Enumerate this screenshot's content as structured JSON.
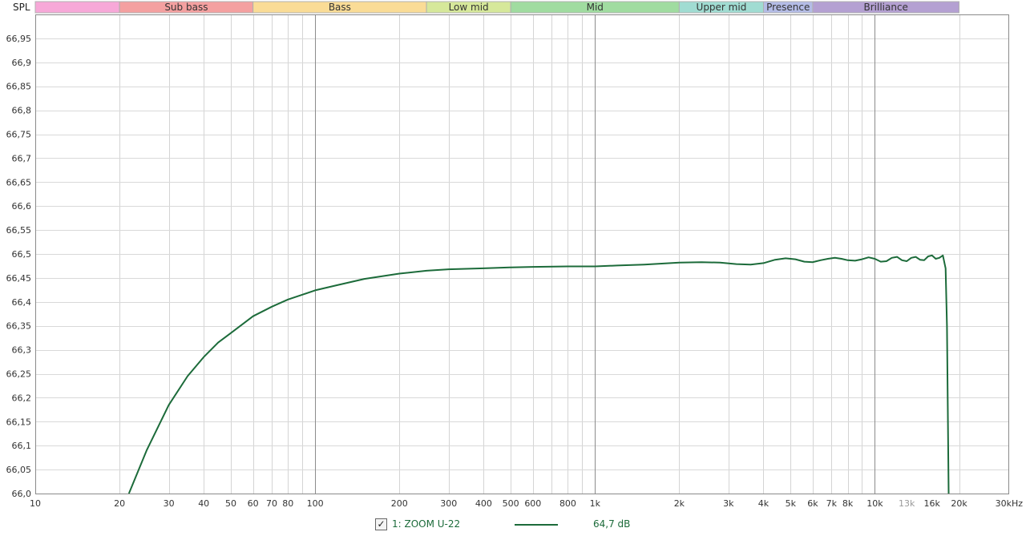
{
  "chart_data": {
    "type": "line",
    "y_axis_label": "SPL",
    "x_axis_unit": "kHz",
    "x_scale": "log",
    "xlim": [
      10,
      30000
    ],
    "ylim": [
      66.0,
      67.0
    ],
    "grid": true,
    "y_tick_labels": [
      "66,0",
      "66,05",
      "66,1",
      "66,15",
      "66,2",
      "66,25",
      "66,3",
      "66,35",
      "66,4",
      "66,45",
      "66,5",
      "66,55",
      "66,6",
      "66,65",
      "66,7",
      "66,75",
      "66,8",
      "66,85",
      "66,9",
      "66,95"
    ],
    "x_tick_labels": [
      {
        "value": 10,
        "label": "10"
      },
      {
        "value": 20,
        "label": "20"
      },
      {
        "value": 30,
        "label": "30"
      },
      {
        "value": 40,
        "label": "40"
      },
      {
        "value": 50,
        "label": "50"
      },
      {
        "value": 60,
        "label": "60"
      },
      {
        "value": 70,
        "label": "70"
      },
      {
        "value": 80,
        "label": "80"
      },
      {
        "value": 100,
        "label": "100"
      },
      {
        "value": 200,
        "label": "200"
      },
      {
        "value": 300,
        "label": "300"
      },
      {
        "value": 400,
        "label": "400"
      },
      {
        "value": 500,
        "label": "500"
      },
      {
        "value": 600,
        "label": "600"
      },
      {
        "value": 800,
        "label": "800"
      },
      {
        "value": 1000,
        "label": "1k"
      },
      {
        "value": 2000,
        "label": "2k"
      },
      {
        "value": 3000,
        "label": "3k"
      },
      {
        "value": 4000,
        "label": "4k"
      },
      {
        "value": 5000,
        "label": "5k"
      },
      {
        "value": 6000,
        "label": "6k"
      },
      {
        "value": 7000,
        "label": "7k"
      },
      {
        "value": 8000,
        "label": "8k"
      },
      {
        "value": 10000,
        "label": "10k"
      },
      {
        "value": 13000,
        "label": "13k",
        "dim": true
      },
      {
        "value": 16000,
        "label": "16k"
      },
      {
        "value": 20000,
        "label": "20k"
      },
      {
        "value": 30000,
        "label": "30kHz"
      }
    ],
    "bands": [
      {
        "label": "",
        "from": 10,
        "to": 20,
        "color": "#f7a8d8"
      },
      {
        "label": "Sub bass",
        "from": 20,
        "to": 60,
        "color": "#f4a0a0"
      },
      {
        "label": "Bass",
        "from": 60,
        "to": 250,
        "color": "#fadc96"
      },
      {
        "label": "Low mid",
        "from": 250,
        "to": 500,
        "color": "#d6e89a"
      },
      {
        "label": "Mid",
        "from": 500,
        "to": 2000,
        "color": "#a0dca0"
      },
      {
        "label": "Upper mid",
        "from": 2000,
        "to": 4000,
        "color": "#a0dcd2"
      },
      {
        "label": "Presence",
        "from": 4000,
        "to": 6000,
        "color": "#b4bce6"
      },
      {
        "label": "Brilliance",
        "from": 6000,
        "to": 20000,
        "color": "#b4a0d2"
      }
    ],
    "series": [
      {
        "name": "1: ZOOM U-22",
        "color": "#1c6b3a",
        "x": [
          21.6,
          25,
          30,
          35,
          40,
          45,
          50,
          60,
          70,
          80,
          90,
          100,
          120,
          150,
          200,
          250,
          300,
          400,
          500,
          600,
          800,
          1000,
          1200,
          1500,
          2000,
          2400,
          2800,
          3200,
          3600,
          4000,
          4400,
          4800,
          5200,
          5600,
          6000,
          6400,
          6800,
          7200,
          7600,
          8000,
          8500,
          9000,
          9500,
          10000,
          10500,
          11000,
          11500,
          12000,
          12500,
          13000,
          13500,
          14000,
          14500,
          15000,
          15500,
          16000,
          16500,
          17000,
          17500,
          17900,
          18100,
          18250,
          18350
        ],
        "y": [
          66.0,
          66.09,
          66.185,
          66.245,
          66.285,
          66.315,
          66.335,
          66.37,
          66.39,
          66.405,
          66.415,
          66.424,
          66.435,
          66.448,
          66.459,
          66.465,
          66.468,
          66.47,
          66.472,
          66.473,
          66.474,
          66.474,
          66.476,
          66.478,
          66.482,
          66.483,
          66.482,
          66.479,
          66.478,
          66.481,
          66.488,
          66.491,
          66.489,
          66.484,
          66.483,
          66.487,
          66.49,
          66.492,
          66.49,
          66.487,
          66.486,
          66.489,
          66.493,
          66.49,
          66.484,
          66.485,
          66.492,
          66.494,
          66.487,
          66.485,
          66.492,
          66.494,
          66.488,
          66.487,
          66.495,
          66.497,
          66.49,
          66.492,
          66.497,
          66.47,
          66.35,
          66.15,
          66.0
        ]
      }
    ]
  },
  "legend": {
    "checkbox_mark": "✓",
    "series_label": "1: ZOOM U-22",
    "level_value": "64,7 dB"
  }
}
